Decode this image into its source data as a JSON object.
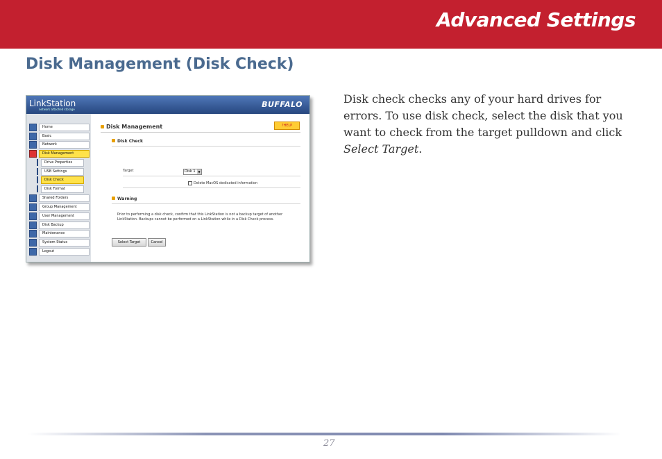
{
  "header": {
    "title": "Advanced Settings"
  },
  "section_title": "Disk Management (Disk Check)",
  "description": {
    "text": "Disk check checks any of your hard drives for errors.  To use disk check, select the disk that you want to check from the target pulldown and click ",
    "italic": "Select Target",
    "end": "."
  },
  "screenshot": {
    "logo": "LinkStation",
    "logo_sub": "network attached storage",
    "brand": "BUFFALO",
    "nav": {
      "home": "Home",
      "basic": "Basic",
      "network": "Network",
      "disk_management": "Disk Management",
      "drive_properties": "Drive Properties",
      "usb_settings": "USB Settings",
      "disk_check": "Disk Check",
      "disk_format": "Disk Format",
      "shared_folders": "Shared Folders",
      "group_management": "Group Management",
      "user_management": "User Management",
      "disk_backup": "Disk Backup",
      "maintenance": "Maintenance",
      "system_status": "System Status",
      "logout": "Logout"
    },
    "page_title": "Disk Management",
    "help": "?HELP",
    "disk_check_heading": "Disk Check",
    "target_label": "Target",
    "target_value": "Disk 1",
    "checkbox_label": "Delete MacOS dedicated information",
    "warning_heading": "Warning",
    "warning_text": "Prior to performing a disk check,  confirm that this LinkStation is not a backup target of another LinkStation. Backups cannot be performed on a LinkStation while in a Disk Check process.",
    "select_target_button": "Select Target",
    "cancel_button": "Cancel"
  },
  "footer": {
    "page_number": "27"
  }
}
